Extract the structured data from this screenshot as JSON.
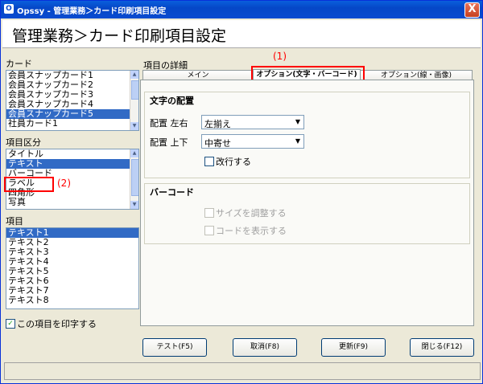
{
  "window": {
    "title": "Opssy - 管理業務＞カード印刷項目設定",
    "close": "X"
  },
  "header": {
    "title": "管理業務＞カード印刷項目設定"
  },
  "card": {
    "label": "カード",
    "items": [
      "会員スナップカード1",
      "会員スナップカード2",
      "会員スナップカード3",
      "会員スナップカード4",
      "会員スナップカード5",
      "社員カード1"
    ],
    "selected": 4
  },
  "category": {
    "label": "項目区分",
    "items": [
      "タイトル",
      "テキスト",
      "バーコード",
      "ラベル",
      "四角形",
      "写真"
    ],
    "selected": 1
  },
  "items": {
    "label": "項目",
    "list": [
      "テキスト1",
      "テキスト2",
      "テキスト3",
      "テキスト4",
      "テキスト5",
      "テキスト6",
      "テキスト7",
      "テキスト8"
    ],
    "selected": 0
  },
  "print_checkbox": {
    "label": "この項目を印字する",
    "checked": true
  },
  "details": {
    "label": "項目の詳細",
    "tabs": [
      "メイン",
      "オプション(文字・バーコード)",
      "オプション(線・画像)"
    ],
    "active_tab": 1
  },
  "text_layout": {
    "title": "文字の配置",
    "horiz_label": "配置 左右",
    "horiz_value": "左揃え",
    "vert_label": "配置 上下",
    "vert_value": "中寄せ",
    "wrap_label": "改行する"
  },
  "barcode": {
    "title": "バーコード",
    "fit_label": "サイズを調整する",
    "show_code_label": "コードを表示する"
  },
  "buttons": {
    "test": "テスト(F5)",
    "cancel": "取消(F8)",
    "update": "更新(F9)",
    "close": "閉じる(F12)"
  },
  "annotations": {
    "a1": "(1)",
    "a2": "(2)"
  },
  "colors": {
    "accent": "#316ac5",
    "annotation": "#ff0000"
  }
}
